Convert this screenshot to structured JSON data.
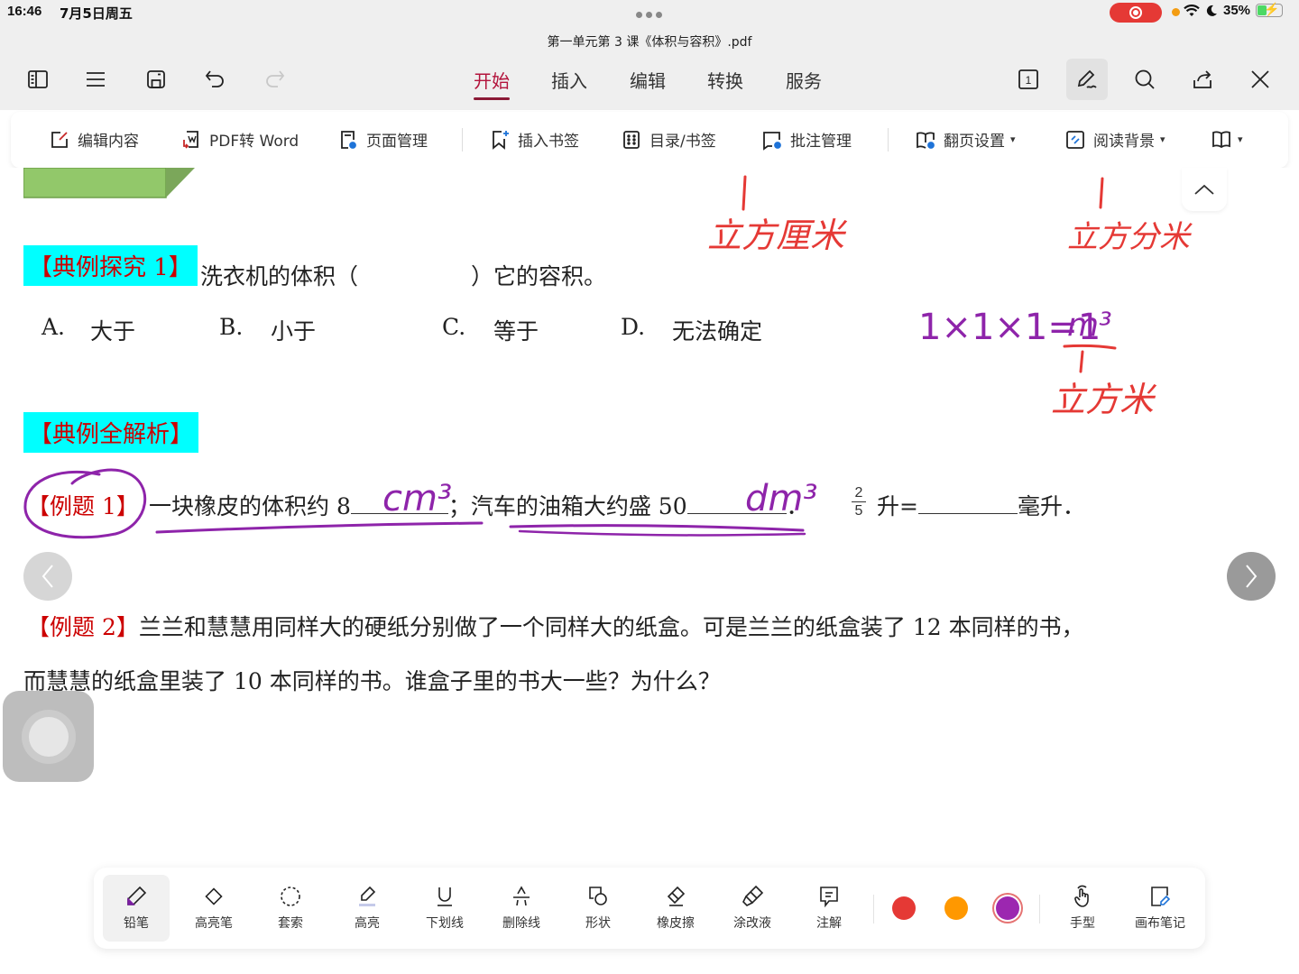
{
  "status_bar": {
    "time": "16:46",
    "date": "7月5日周五",
    "battery": "35%"
  },
  "document": {
    "title": "第一单元第 3 课《体积与容积》.pdf"
  },
  "toolbar": {
    "left_icons": [
      "sidebar-icon",
      "menu-icon",
      "save-icon",
      "undo-icon",
      "redo-icon"
    ],
    "right_icons": [
      "page-number-icon",
      "pen-edit-icon",
      "search-icon",
      "share-icon",
      "close-icon"
    ],
    "page_badge": "1"
  },
  "tabs": [
    {
      "label": "开始",
      "active": true
    },
    {
      "label": "插入",
      "active": false
    },
    {
      "label": "编辑",
      "active": false
    },
    {
      "label": "转换",
      "active": false
    },
    {
      "label": "服务",
      "active": false
    }
  ],
  "ribbon": [
    {
      "label": "编辑内容",
      "icon": "edit-content-icon"
    },
    {
      "label": "PDF转 Word",
      "icon": "pdf-to-word-icon"
    },
    {
      "label": "页面管理",
      "icon": "page-manage-icon"
    },
    {
      "label": "插入书签",
      "icon": "insert-bookmark-icon"
    },
    {
      "label": "目录/书签",
      "icon": "toc-icon"
    },
    {
      "label": "批注管理",
      "icon": "annotation-manage-icon"
    },
    {
      "label": "翻页设置",
      "icon": "page-turn-icon",
      "dropdown": true
    },
    {
      "label": "阅读背景",
      "icon": "reading-bg-icon",
      "dropdown": true
    },
    {
      "label": "",
      "icon": "book-view-icon",
      "dropdown": true
    }
  ],
  "content": {
    "example_explore": {
      "tag": "【典例探究 1】",
      "question": "洗衣机的体积（　　　　　）它的容积。",
      "options": [
        {
          "letter": "A.",
          "text": "大于"
        },
        {
          "letter": "B.",
          "text": "小于"
        },
        {
          "letter": "C.",
          "text": "等于"
        },
        {
          "letter": "D.",
          "text": "无法确定"
        }
      ]
    },
    "analysis_tag": "【典例全解析】",
    "example1": {
      "tag": "【例题 1】",
      "part1": "一块橡皮的体积约 8",
      "part2": "；汽车的油箱大约盛 50",
      "part3": "．",
      "fraction_num": "2",
      "fraction_den": "5",
      "part4": "升=",
      "part5": "毫升．"
    },
    "example2": {
      "tag": "【例题 2】",
      "line1": "兰兰和慧慧用同样大的硬纸分别做了一个同样大的纸盒。可是兰兰的纸盒装了 12 本同样的书，",
      "line2": "而慧慧的纸盒里装了 10 本同样的书。谁盒子里的书大一些？为什么？"
    }
  },
  "handwriting": {
    "note_cm": "立方厘米",
    "note_dm": "立方分米",
    "formula": "1×1×1=1",
    "unit_m3": "m³",
    "note_m": "立方米",
    "answer1": "cm³",
    "answer2": "dm³"
  },
  "annotation_toolbar": {
    "tools": [
      {
        "label": "铅笔",
        "icon": "pencil-icon",
        "active": true
      },
      {
        "label": "高亮笔",
        "icon": "highlighter-pen-icon"
      },
      {
        "label": "套索",
        "icon": "lasso-icon"
      },
      {
        "label": "高亮",
        "icon": "highlight-icon"
      },
      {
        "label": "下划线",
        "icon": "underline-icon"
      },
      {
        "label": "删除线",
        "icon": "strikethrough-icon"
      },
      {
        "label": "形状",
        "icon": "shape-icon"
      },
      {
        "label": "橡皮擦",
        "icon": "eraser-icon"
      },
      {
        "label": "涂改液",
        "icon": "correction-fluid-icon"
      },
      {
        "label": "注解",
        "icon": "note-icon"
      }
    ],
    "colors": [
      {
        "name": "red",
        "hex": "#e53935"
      },
      {
        "name": "orange",
        "hex": "#ff9800"
      },
      {
        "name": "purple",
        "hex": "#9c27b0",
        "selected": true
      }
    ],
    "extra": [
      {
        "label": "手型",
        "icon": "hand-icon"
      },
      {
        "label": "画布笔记",
        "icon": "canvas-note-icon"
      }
    ]
  },
  "colors": {
    "accent": "#b3143c",
    "ink_red": "#e53935",
    "ink_purple": "#8e24aa",
    "tag_bg": "#00ffff",
    "tag_text": "#cc0000"
  }
}
